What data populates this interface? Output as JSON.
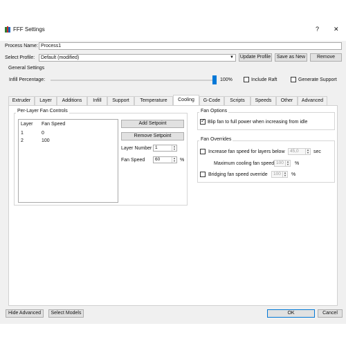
{
  "window": {
    "title": "FFF Settings",
    "help_label": "?",
    "close_label": "✕"
  },
  "process": {
    "name_label": "Process Name:",
    "name_value": "Process1",
    "profile_label": "Select Profile:",
    "profile_value": "Default (modified)",
    "update_profile_label": "Update Profile",
    "save_as_new_label": "Save as New",
    "remove_label": "Remove"
  },
  "general": {
    "title": "General Settings",
    "infill_label": "Infill Percentage:",
    "infill_value": "100%",
    "infill_fraction": 1.0,
    "include_raft_label": "Include Raft",
    "generate_support_label": "Generate Support"
  },
  "tabs": [
    {
      "label": "Extruder"
    },
    {
      "label": "Layer"
    },
    {
      "label": "Additions"
    },
    {
      "label": "Infill"
    },
    {
      "label": "Support"
    },
    {
      "label": "Temperature"
    },
    {
      "label": "Cooling"
    },
    {
      "label": "G-Code"
    },
    {
      "label": "Scripts"
    },
    {
      "label": "Speeds"
    },
    {
      "label": "Other"
    },
    {
      "label": "Advanced"
    }
  ],
  "active_tab": "Cooling",
  "fan_controls": {
    "title": "Per-Layer Fan Controls",
    "columns": [
      "Layer",
      "Fan Speed"
    ],
    "rows": [
      {
        "layer": "1",
        "speed": "0"
      },
      {
        "layer": "2",
        "speed": "100"
      }
    ],
    "add_setpoint_label": "Add Setpoint",
    "remove_setpoint_label": "Remove Setpoint",
    "layer_number_label": "Layer Number",
    "layer_number_value": "1",
    "fan_speed_label": "Fan Speed",
    "fan_speed_value": "60",
    "fan_speed_unit": "%"
  },
  "fan_options": {
    "title": "Fan Options",
    "blip_label": "Blip fan to full power when increasing from idle"
  },
  "fan_overrides": {
    "title": "Fan Overrides",
    "increase_label": "Increase fan speed for layers below",
    "increase_value": "45,0",
    "increase_unit": "sec",
    "max_cooling_label": "Maximum cooling fan speed",
    "max_cooling_value": "100",
    "max_cooling_unit": "%",
    "bridging_label": "Bridging fan speed override",
    "bridging_value": "100",
    "bridging_unit": "%"
  },
  "footer": {
    "hide_advanced_label": "Hide Advanced",
    "select_models_label": "Select Models",
    "ok_label": "OK",
    "cancel_label": "Cancel"
  }
}
